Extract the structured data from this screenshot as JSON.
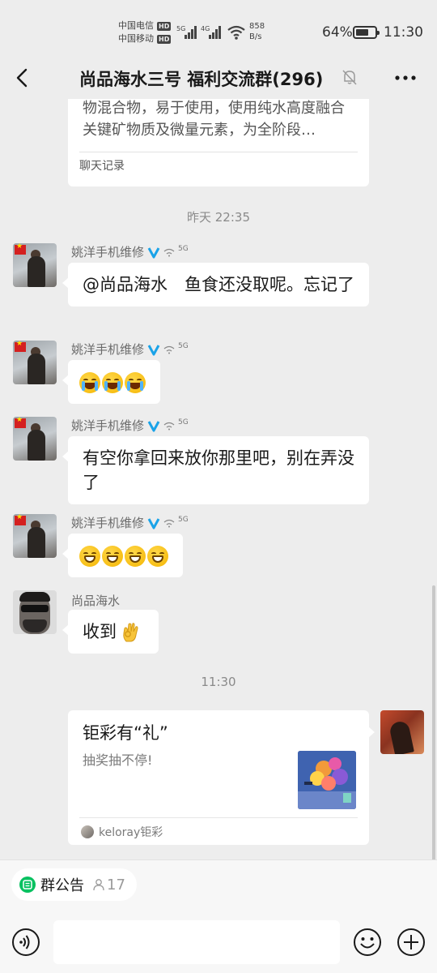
{
  "status_bar": {
    "carrier1": "中国电信",
    "carrier2": "中国移动",
    "hd": "HD",
    "net1": "5G",
    "net2": "4G",
    "speed_value": "858",
    "speed_unit": "B/s",
    "battery": "64%",
    "battery_level": 0.64,
    "time": "11:30"
  },
  "header": {
    "title": "尚品海水三号 福利交流群(296)"
  },
  "chat": {
    "prev_card": {
      "text": "物混合物，易于使用，使用纯水高度融合关键矿物质及微量元素，为全阶段…",
      "footer": "聊天记录"
    },
    "timestamp1": "昨天 22:35",
    "timestamp2": "11:30",
    "messages": [
      {
        "sender": "姚洋手机维修",
        "text": "@尚品海水　鱼食还没取呢。忘记了"
      },
      {
        "sender": "姚洋手机维修",
        "emoji": "crying-face-x3"
      },
      {
        "sender": "姚洋手机维修",
        "text": "有空你拿回来放你那里吧，别在弄没了"
      },
      {
        "sender": "姚洋手机维修",
        "emoji": "grinning-face-x4"
      },
      {
        "sender": "尚品海水",
        "text": "收到"
      }
    ],
    "net_badge": "5G",
    "link_card": {
      "title": "钜彩有“礼”",
      "desc": "抽奖抽不停!",
      "source": "keloray钜彩"
    }
  },
  "bottom": {
    "notice_label": "群公告",
    "notice_count": "17"
  },
  "colors": {
    "background": "#ededed",
    "bubble": "#ffffff",
    "accent_green": "#07c160",
    "v_badge": "#1aa3e8"
  },
  "icons": [
    "back-arrow-icon",
    "mute-bell-icon",
    "more-icon",
    "voice-icon",
    "emoji-icon",
    "plus-icon",
    "announcement-icon",
    "person-icon",
    "verified-v-icon",
    "ok-hand-icon"
  ]
}
